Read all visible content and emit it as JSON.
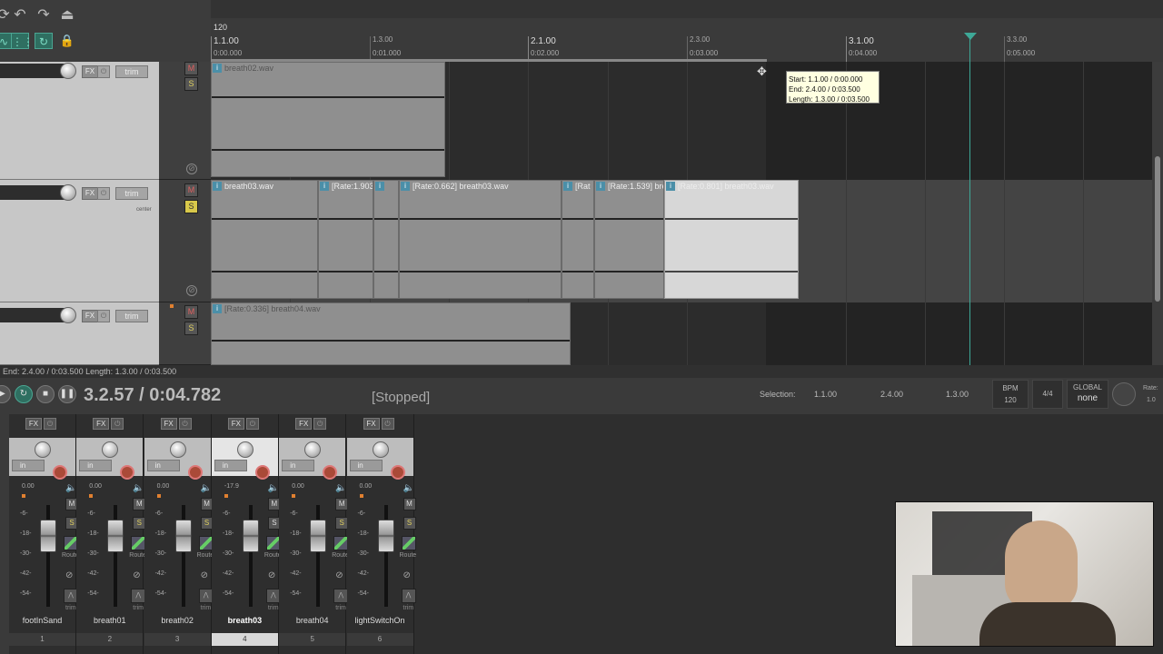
{
  "ruler": {
    "tempo": "120",
    "bars": [
      {
        "label": "1.1.00",
        "time": "0:00.000"
      },
      {
        "label": "2.1.00",
        "time": "0:02.000"
      },
      {
        "label": "3.1.00",
        "time": "0:04.000"
      }
    ],
    "beats": [
      {
        "label": "1.3.00",
        "time": "0:01.000"
      },
      {
        "label": "2.3.00",
        "time": "0:03.000"
      },
      {
        "label": "3.3.00",
        "time": "0:05.000"
      }
    ]
  },
  "tooltip": {
    "start": "Start: 1.1.00 / 0:00.000",
    "end": "End: 2.4.00 / 0:03.500",
    "length": "Length: 1.3.00 / 0:03.500"
  },
  "tracks": [
    {
      "fx": "FX",
      "trim": "trim",
      "m": "M",
      "s": "S"
    },
    {
      "fx": "FX",
      "trim": "trim",
      "m": "M",
      "s": "S",
      "pan": "center"
    },
    {
      "fx": "FX",
      "trim": "trim",
      "m": "M",
      "s": "S"
    }
  ],
  "items": {
    "track1": {
      "name": "breath02.wav"
    },
    "track2": [
      {
        "name": "breath03.wav"
      },
      {
        "name": "[Rate:1.903"
      },
      {
        "name": ""
      },
      {
        "name": "[Rate:0.662] breath03.wav"
      },
      {
        "name": "[Rat"
      },
      {
        "name": "[Rate:1.539] bre"
      },
      {
        "name": "[Rate:0.801] breath03.wav"
      }
    ],
    "track3": {
      "name": "[Rate:0.336] breath04.wav"
    }
  },
  "status_line": "End: 2.4.00 / 0:03.500 Length: 1.3.00 / 0:03.500",
  "transport": {
    "timecode": "3.2.57 / 0:04.782",
    "state": "[Stopped]",
    "selection_label": "Selection:",
    "sel_start": "1.1.00",
    "sel_end": "2.4.00",
    "sel_length": "1.3.00",
    "bpm_label": "BPM",
    "bpm": "120",
    "time_sig": "4/4",
    "global_label": "GLOBAL",
    "global_value": "none",
    "rate_label": "Rate:",
    "rate_value": "1.0"
  },
  "mixer": {
    "channels": [
      {
        "name": "footInSand",
        "num": "1",
        "peak": "0.00",
        "in": "in",
        "fx": "FX",
        "m": "M",
        "s": "S",
        "route": "Route",
        "trim": "trim"
      },
      {
        "name": "breath01",
        "num": "2",
        "peak": "0.00",
        "in": "in",
        "fx": "FX",
        "m": "M",
        "s": "S",
        "route": "Route",
        "trim": "trim"
      },
      {
        "name": "breath02",
        "num": "3",
        "peak": "0.00",
        "in": "in",
        "fx": "FX",
        "m": "M",
        "s": "S",
        "route": "Route",
        "trim": "trim"
      },
      {
        "name": "breath03",
        "num": "4",
        "peak": "-17.9",
        "in": "in",
        "fx": "FX",
        "m": "M",
        "s": "S",
        "route": "Route",
        "trim": "trim"
      },
      {
        "name": "breath04",
        "num": "5",
        "peak": "0.00",
        "in": "in",
        "fx": "FX",
        "m": "M",
        "s": "S",
        "route": "Route",
        "trim": "trim"
      },
      {
        "name": "lightSwitchOn",
        "num": "6",
        "peak": "0.00",
        "in": "in",
        "fx": "FX",
        "m": "M",
        "s": "S",
        "route": "Route",
        "trim": "trim"
      }
    ],
    "db_ticks": [
      "-6-",
      "-18-",
      "-30-",
      "-42-",
      "-54-"
    ]
  },
  "colors": {
    "accent": "#3ea897",
    "solo_active": "#d8c84a",
    "record_arm": "#aa4a38"
  }
}
